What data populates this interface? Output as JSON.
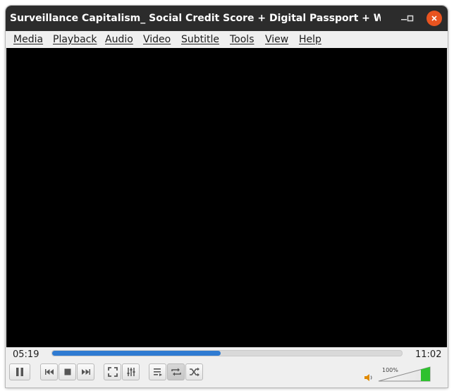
{
  "window": {
    "title": "Surveillance Capitalism_ Social Credit Score + Digital Passport + War O..."
  },
  "menu": {
    "media": "Media",
    "playback": "Playback",
    "audio": "Audio",
    "video": "Video",
    "subtitle": "Subtitle",
    "tools": "Tools",
    "view": "View",
    "help": "Help"
  },
  "player": {
    "elapsed": "05:19",
    "total": "11:02",
    "progress_fraction": 0.482,
    "volume_label": "100%",
    "volume_fraction": 1.0,
    "loop_active": true
  },
  "colors": {
    "titlebar": "#2c2c2c",
    "close_button": "#e95420",
    "seek_fill": "#2f7bd2",
    "volume_green": "#2fc12f"
  },
  "icons": {
    "pause": "pause-icon",
    "previous": "skip-previous-icon",
    "stop": "stop-icon",
    "next": "skip-next-icon",
    "fullscreen": "fullscreen-icon",
    "extended": "equalizer-sliders-icon",
    "playlist": "playlist-icon",
    "loop": "loop-icon",
    "shuffle": "shuffle-icon",
    "volume": "speaker-icon"
  }
}
